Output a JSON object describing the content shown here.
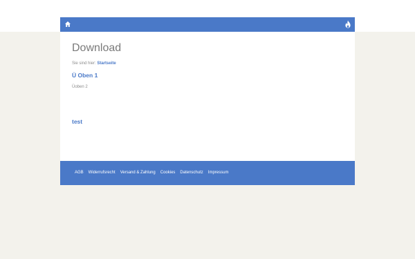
{
  "colors": {
    "accent": "#4a79c8",
    "background": "#f3f2ec",
    "panel": "#ffffff",
    "title_text": "#7a7a7a",
    "muted_text": "#8c8c8c"
  },
  "navbar": {
    "home_icon": "home-icon",
    "fire_icon": "fire-icon"
  },
  "main": {
    "title": "Download",
    "breadcrumb": {
      "prefix": "Sie sind hier:",
      "current": "Startseite"
    },
    "heading_1": "Ü Oben 1",
    "heading_2": "Üoben 2",
    "link": "test"
  },
  "footer": {
    "links": [
      "AGB",
      "Widerrufsrecht",
      "Versand & Zahlung",
      "Cookies",
      "Datenschutz",
      "Impressum"
    ]
  }
}
